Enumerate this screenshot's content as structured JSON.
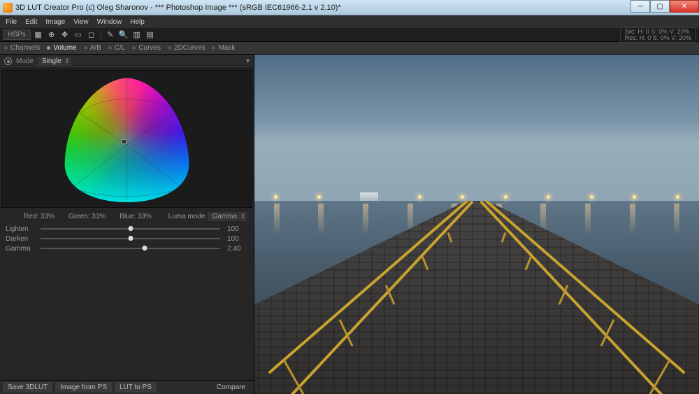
{
  "window": {
    "title": "3D LUT Creator Pro (c) Oleg Sharonov - *** Photoshop Image *** (sRGB IEC61966-2.1 v 2.10)*"
  },
  "menu": [
    "File",
    "Edit",
    "Image",
    "View",
    "Window",
    "Help"
  ],
  "toolbar": {
    "colorspace": "HSPs"
  },
  "readout": {
    "line1": "Src: H:    0     S:   0%   V:  20%",
    "line2": "Res: H:    0     S:   0%   V:  20%"
  },
  "tabs": [
    "Channels",
    "Volume",
    "A/B",
    "C/L",
    "Curves",
    "2DCurves",
    "Mask"
  ],
  "activeTabIndex": 1,
  "mode": {
    "label": "Mode",
    "value": "Single"
  },
  "rgb": {
    "red_label": "Red:",
    "red_val": "33%",
    "green_label": "Green:",
    "green_val": "33%",
    "blue_label": "Blue:",
    "blue_val": "33%"
  },
  "luma": {
    "label": "Luma mode",
    "value": "Gamma"
  },
  "sliders": [
    {
      "label": "Lighten",
      "value": "100",
      "pos": 50
    },
    {
      "label": "Darken",
      "value": "100",
      "pos": 50
    },
    {
      "label": "Gamma",
      "value": "2.40",
      "pos": 58
    }
  ],
  "buttons": {
    "save": "Save 3DLUT",
    "from_ps": "Image from PS",
    "to_ps": "LUT to PS",
    "compare": "Compare"
  }
}
